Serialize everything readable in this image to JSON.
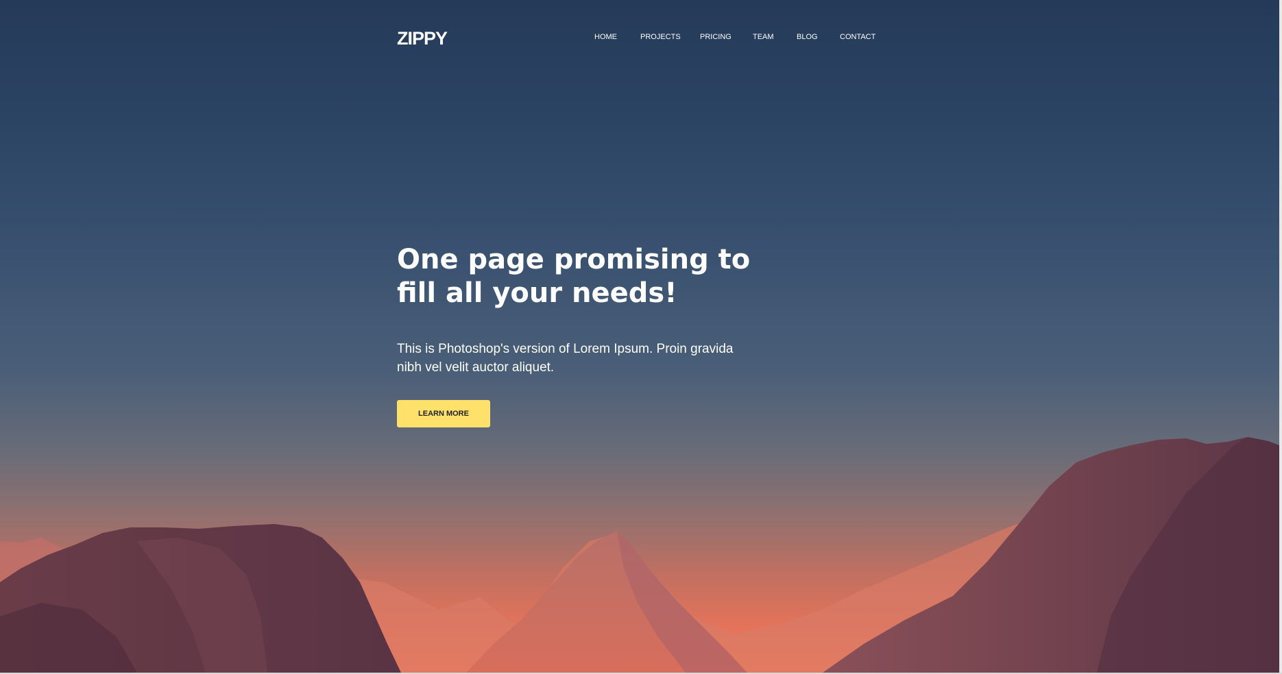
{
  "brand": {
    "logo_text": "ZIPPY"
  },
  "nav": {
    "items": [
      {
        "label": "HOME"
      },
      {
        "label": "PROJECTS"
      },
      {
        "label": "PRICING"
      },
      {
        "label": "TEAM"
      },
      {
        "label": "BLOG"
      },
      {
        "label": "CONTACT"
      }
    ]
  },
  "hero": {
    "headline": "One page promising to fill all your needs!",
    "subtext": "This is Photoshop's version of Lorem Ipsum. Proin gravida nibh vel velit auctor aliquet.",
    "cta_label": "LEARN MORE"
  },
  "colors": {
    "sky_top": "#243a58",
    "sky_horizon": "#f07a5a",
    "cta_background": "#fde16a",
    "text": "#ffffff"
  }
}
